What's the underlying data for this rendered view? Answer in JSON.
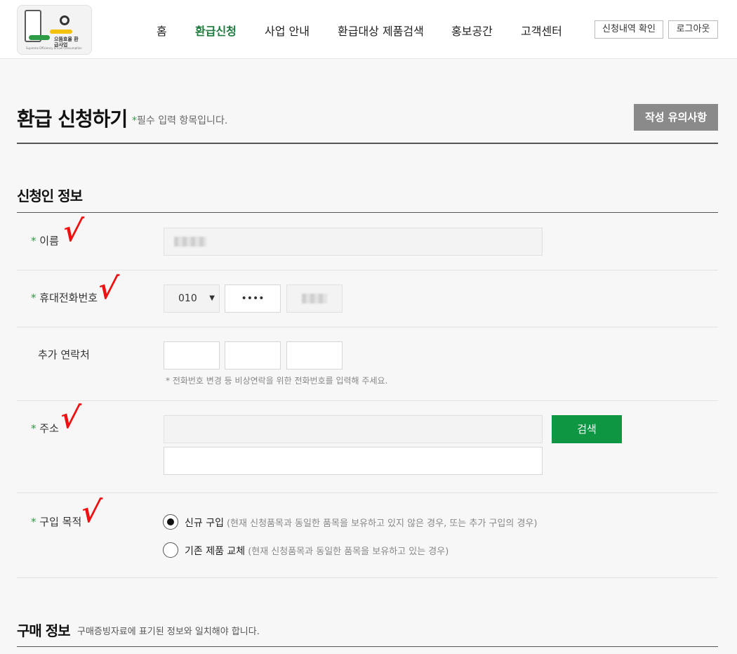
{
  "header": {
    "logo_text": "으뜸효율 환급사업",
    "logo_sub": "Supreme Efficiency & Low Consumption",
    "nav": [
      "홈",
      "환급신청",
      "사업 안내",
      "환급대상 제품검색",
      "홍보공간",
      "고객센터"
    ],
    "active_nav": "환급신청",
    "history_button": "신청내역 확인",
    "logout_button": "로그아웃"
  },
  "page": {
    "title": "환급 신청하기",
    "required_mark": "*",
    "required_note": "필수 입력 항목입니다.",
    "notice_button": "작성 유의사항"
  },
  "applicant": {
    "section_title": "신청인 정보",
    "name_label": "이름",
    "phone_label": "휴대전화번호",
    "phone_prefix": "010",
    "phone_middle": "••••",
    "extra_label": "추가 연락처",
    "extra_hint": "* 전화번호 변경 등 비상연락을 위한 전화번호를 입력해 주세요.",
    "address_label": "주소",
    "search_button": "검색",
    "purpose_label": "구입 목적",
    "purpose_options": [
      {
        "label": "신규 구입",
        "desc": "(현재 신청품목과 동일한 품목을 보유하고 있지 않은 경우, 또는 추가 구입의 경우)",
        "selected": true
      },
      {
        "label": "기존 제품 교체",
        "desc": "(현재 신청품목과 동일한 품목을 보유하고 있는 경우)",
        "selected": false
      }
    ],
    "check_mark": "√"
  },
  "purchase": {
    "section_title": "구매 정보",
    "note": "구매증빙자료에 표기된 정보와 일치해야 합니다."
  },
  "colors": {
    "accent_green": "#0e9642",
    "nav_active": "#1e7a3e",
    "check_red": "#e11111",
    "notice_gray": "#8a8a8a"
  }
}
